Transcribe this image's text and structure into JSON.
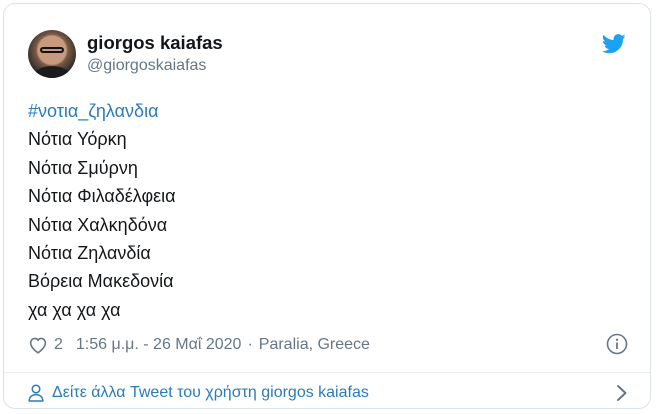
{
  "tweet": {
    "author": {
      "name": "giorgos kaiafas",
      "handle": "@giorgoskaiafas"
    },
    "hashtag": "#νοτια_ζηλανδια",
    "lines": [
      "Νότια Υόρκη",
      "Νότια Σμύρνη",
      "Νότια Φιλαδέλφεια",
      "Νότια Χαλκηδόνα",
      "Νότια Ζηλανδία",
      "Βόρεια Μακεδονία",
      "χα χα χα χα"
    ],
    "likes": "2",
    "time": "1:56 μ.μ. - 26 Μαΐ 2020",
    "separator": "·",
    "location": "Paralia, Greece",
    "more_link": "Δείτε άλλα Tweet του χρήστη giorgos kaiafas"
  },
  "icons": {
    "brand": "twitter-bird-icon",
    "like": "heart-icon",
    "info": "info-icon",
    "profile": "person-icon",
    "chevron": "chevron-right-icon"
  },
  "colors": {
    "twitter_blue": "#1da1f2",
    "link": "#2b7bb9",
    "secondary_text": "#657786",
    "primary_text": "#14171a",
    "border": "#dce3e8"
  }
}
